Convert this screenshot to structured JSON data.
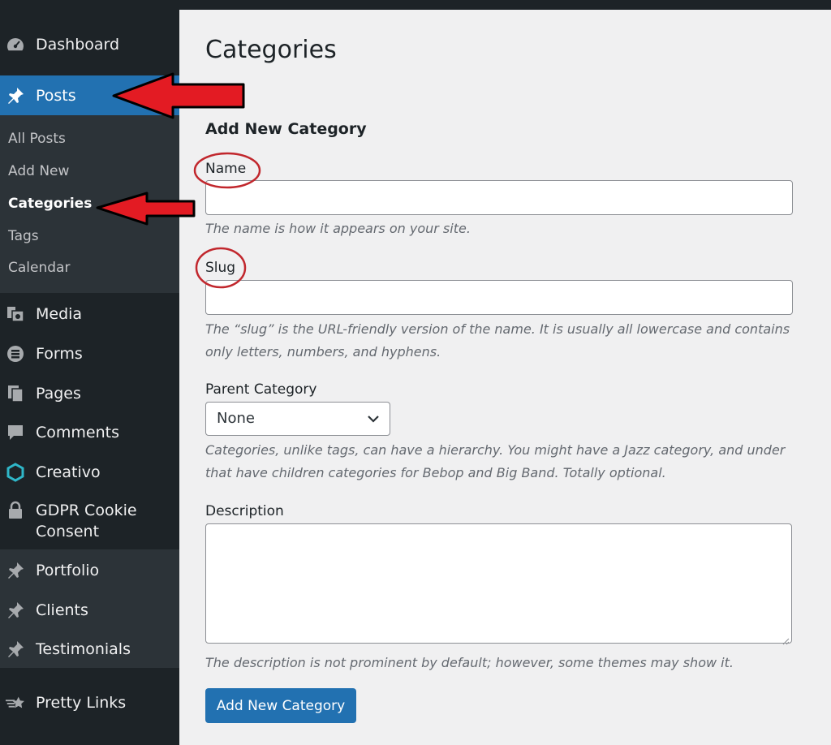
{
  "sidebar": {
    "items": [
      {
        "label": "Dashboard",
        "icon": "dashboard-icon"
      },
      {
        "label": "Posts",
        "icon": "pin-icon",
        "current": true
      },
      {
        "label": "Media",
        "icon": "media-icon"
      },
      {
        "label": "Forms",
        "icon": "forms-icon"
      },
      {
        "label": "Pages",
        "icon": "pages-icon"
      },
      {
        "label": "Comments",
        "icon": "comment-icon"
      },
      {
        "label": "Creativo",
        "icon": "hexagon-icon"
      },
      {
        "label": "GDPR Cookie",
        "label2": "Consent",
        "icon": "lock-icon"
      },
      {
        "label": "Portfolio",
        "icon": "pin-icon"
      },
      {
        "label": "Clients",
        "icon": "pin-icon"
      },
      {
        "label": "Testimonials",
        "icon": "pin-icon"
      },
      {
        "label": "Pretty Links",
        "icon": "star-icon"
      }
    ],
    "submenu": [
      {
        "label": "All Posts"
      },
      {
        "label": "Add New"
      },
      {
        "label": "Categories",
        "active": true
      },
      {
        "label": "Tags"
      },
      {
        "label": "Calendar"
      }
    ]
  },
  "main": {
    "title": "Categories",
    "section_title": "Add New Category",
    "name_label": "Name",
    "name_value": "",
    "name_help": "The name is how it appears on your site.",
    "slug_label": "Slug",
    "slug_value": "",
    "slug_help_line1": "The “slug” is the URL-friendly version of the name. It is usually all lowercase and contains",
    "slug_help_line2": "only letters, numbers, and hyphens.",
    "parent_label": "Parent Category",
    "parent_selected": "None",
    "parent_help_line1": "Categories, unlike tags, can have a hierarchy. You might have a Jazz category, and under",
    "parent_help_line2": "that have children categories for Bebop and Big Band. Totally optional.",
    "description_label": "Description",
    "description_value": "",
    "description_help": "The description is not prominent by default; however, some themes may show it.",
    "submit_label": "Add New Category"
  },
  "colors": {
    "sidebar_bg": "#1d2327",
    "submenu_bg": "#2c3338",
    "accent": "#2271b1",
    "annotation_red": "#e31b23"
  }
}
